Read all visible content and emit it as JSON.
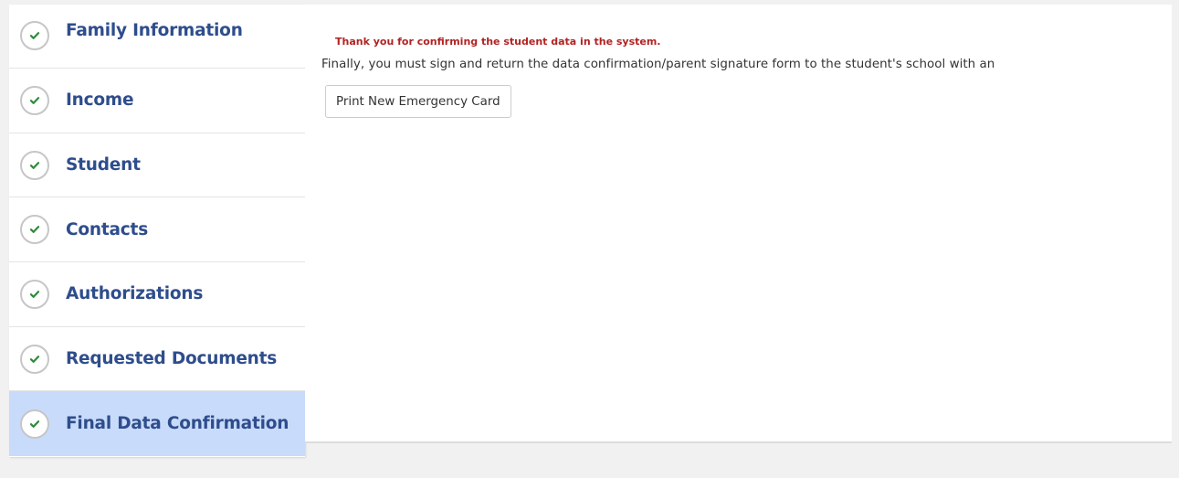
{
  "sidebar": {
    "items": [
      {
        "label": "Family Information",
        "state": "complete"
      },
      {
        "label": "Income",
        "state": "complete"
      },
      {
        "label": "Student",
        "state": "complete"
      },
      {
        "label": "Contacts",
        "state": "complete"
      },
      {
        "label": "Authorizations",
        "state": "complete"
      },
      {
        "label": "Requested Documents",
        "state": "complete"
      },
      {
        "label": "Final Data Confirmation",
        "state": "complete",
        "active": true
      }
    ]
  },
  "main": {
    "thank_you_message": "Thank you for confirming the student data in the system.",
    "instructions": "Finally, you must sign and return the data confirmation/parent signature form to the student's school with an",
    "print_button_label": "Print New Emergency Card"
  },
  "colors": {
    "accent_label": "#2e4d8c",
    "check_green": "#2e8b3a",
    "active_bg": "#c9dbfa",
    "message_red": "#b22222"
  },
  "icons": {
    "step_status": "check-circle-icon"
  }
}
